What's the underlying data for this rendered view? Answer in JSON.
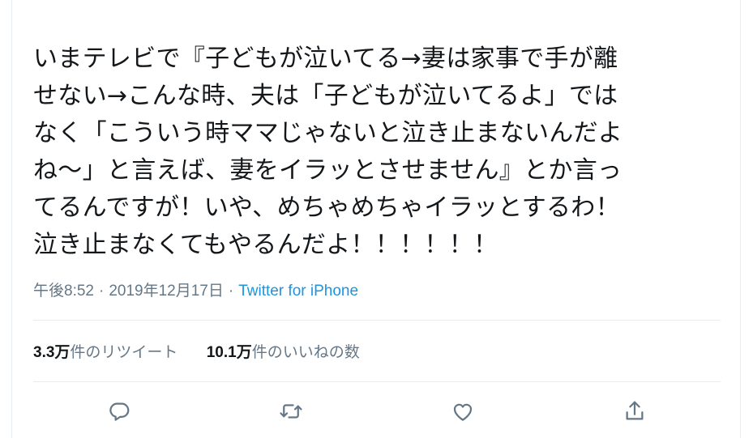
{
  "tweet": {
    "text_lines": [
      "いまテレビで『子どもが泣いてる→妻は家事で手が離",
      "せない→こんな時、夫は「子どもが泣いてるよ」では",
      "なく「こういう時ママじゃないと泣き止まないんだよ",
      "ね〜」と言えば、妻をイラッとさせません』とか言っ",
      "てるんですが！いや、めちゃめちゃイラッとするわ！",
      "泣き止まなくてもやるんだよ！！！！！！"
    ]
  },
  "meta": {
    "time": "午後8:52",
    "separator": "·",
    "date": "2019年12月17日",
    "source": "Twitter for iPhone"
  },
  "stats": {
    "retweets_count": "3.3万",
    "retweets_label": "件のリツイート",
    "likes_count": "10.1万",
    "likes_label": "件のいいねの数"
  },
  "actions": {
    "reply_icon": "reply-icon",
    "retweet_icon": "retweet-icon",
    "like_icon": "heart-icon",
    "share_icon": "share-icon"
  },
  "colors": {
    "text": "#14171a",
    "muted": "#657786",
    "link": "#1b95e0",
    "border": "#e6ecf0"
  }
}
